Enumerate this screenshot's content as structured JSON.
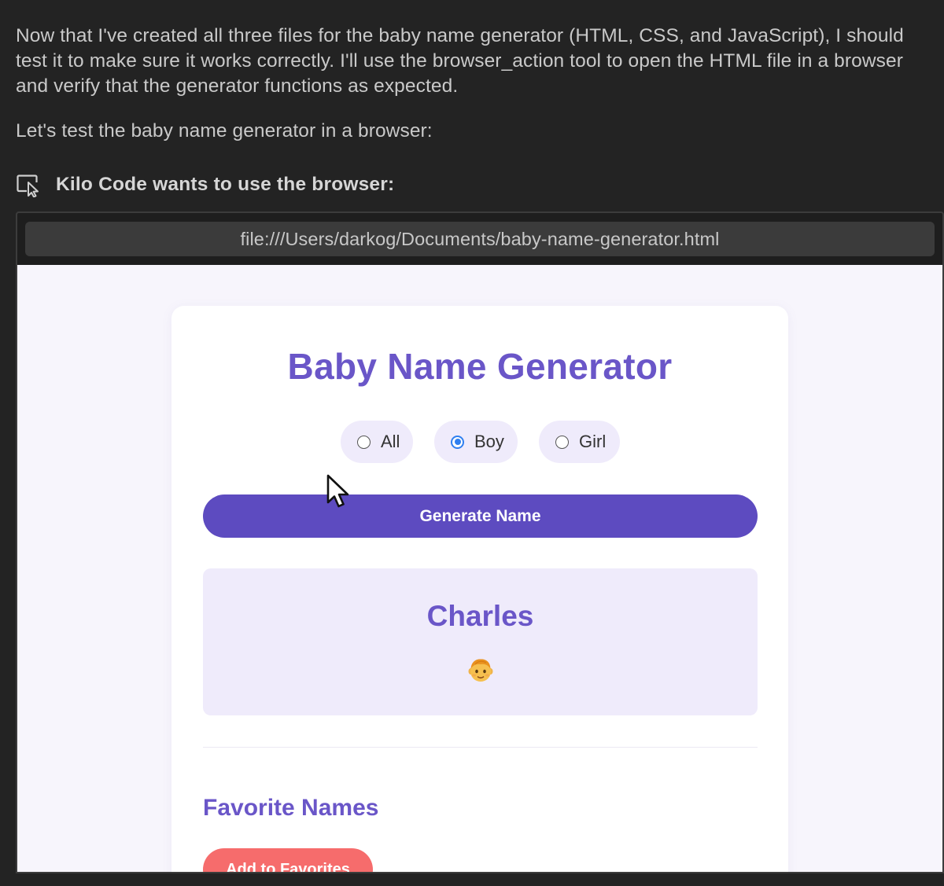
{
  "chat": {
    "paragraph_1": "Now that I've created all three files for the baby name generator (HTML, CSS, and JavaScript), I should test it to make sure it works correctly. I'll use the browser_action tool to open the HTML file in a browser and verify that the generator functions as expected.",
    "paragraph_2": "Let's test the baby name generator in a browser:",
    "tool_header": "Kilo Code wants to use the browser:",
    "tool_icon": "browser-pointer-icon"
  },
  "browser": {
    "url": "file:///Users/darkog/Documents/baby-name-generator.html"
  },
  "app": {
    "title": "Baby Name Generator",
    "gender_options": [
      {
        "label": "All",
        "selected": false
      },
      {
        "label": "Boy",
        "selected": true
      },
      {
        "label": "Girl",
        "selected": false
      }
    ],
    "generate_label": "Generate Name",
    "result_name": "Charles",
    "result_emoji": "boy-face-emoji",
    "favorites_title": "Favorite Names",
    "add_favorites_label": "Add to Favorites"
  },
  "colors": {
    "background": "#232323",
    "accent_purple": "#6a56c8",
    "button_purple": "#5d4bc0",
    "pill_lavender": "#efebfb",
    "favorites_red": "#f66c6c",
    "radio_blue": "#2f7ff0"
  }
}
